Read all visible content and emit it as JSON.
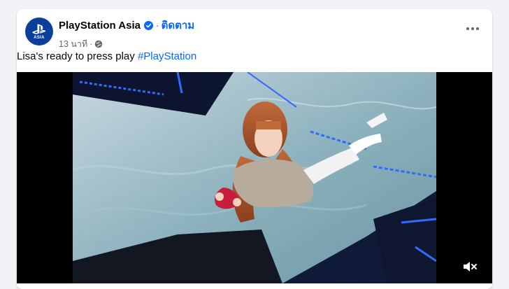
{
  "post": {
    "page_name": "PlayStation Asia",
    "avatar_text": "ASIA",
    "follow_label": "ติดตาม",
    "separator": "·",
    "time": "13 นาที",
    "caption_text": "Lisa's ready to press play ",
    "hashtag": "#PlayStation"
  },
  "colors": {
    "link": "#0866ff",
    "brand": "#0a3f9b",
    "background": "#f0f2f5"
  },
  "icons": {
    "verified": "verified-badge-icon",
    "privacy": "globe-icon",
    "more": "more-options-icon",
    "sound": "speaker-muted-icon"
  }
}
